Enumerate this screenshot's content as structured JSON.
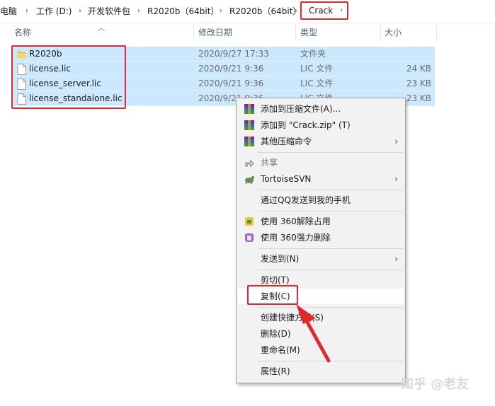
{
  "breadcrumb": {
    "items": [
      "电脑",
      "工作 (D:)",
      "开发软件包",
      "R2020b（64bit）",
      "R2020b（64bit）"
    ],
    "current": "Crack",
    "separator": "›"
  },
  "columns": {
    "name": "名称",
    "date": "修改日期",
    "type": "类型",
    "size": "大小"
  },
  "files": [
    {
      "name": "R2020b",
      "date": "2020/9/27 17:33",
      "type": "文件夹",
      "size": "",
      "icon": "folder-icon"
    },
    {
      "name": "license.lic",
      "date": "2020/9/21 9:36",
      "type": "LIC 文件",
      "size": "24 KB",
      "icon": "file-icon"
    },
    {
      "name": "license_server.lic",
      "date": "2020/9/21 9:36",
      "type": "LIC 文件",
      "size": "23 KB",
      "icon": "file-icon"
    },
    {
      "name": "license_standalone.lic",
      "date": "2020/9/21 9:36",
      "type": "LIC 文件",
      "size": "23 KB",
      "icon": "file-icon"
    }
  ],
  "context_menu": {
    "items": [
      {
        "label": "添加到压缩文件(A)...",
        "icon": "winrar-icon"
      },
      {
        "label": "添加到 \"Crack.zip\" (T)",
        "icon": "winrar-icon"
      },
      {
        "label": "其他压缩命令",
        "icon": "winrar-icon",
        "submenu": true
      },
      {
        "label": "共享",
        "icon": "share-icon",
        "disabled": true
      },
      {
        "label": "TortoiseSVN",
        "icon": "tortoisesvn-icon",
        "submenu": true
      },
      {
        "label": "通过QQ发送到我的手机"
      },
      {
        "label": "使用 360解除占用",
        "icon": "360-unlock-icon"
      },
      {
        "label": "使用 360强力删除",
        "icon": "360-delete-icon"
      },
      {
        "label": "发送到(N)",
        "submenu": true
      },
      {
        "label": "剪切(T)"
      },
      {
        "label": "复制(C)",
        "highlighted": true
      },
      {
        "label": "创建快捷方式(S)"
      },
      {
        "label": "删除(D)"
      },
      {
        "label": "重命名(M)"
      },
      {
        "label": "属性(R)"
      }
    ]
  },
  "watermark": "知乎 @老友",
  "colors": {
    "selection": "#cce8ff",
    "annotation": "#e0282e",
    "menu_bg": "#f2f2f2"
  }
}
